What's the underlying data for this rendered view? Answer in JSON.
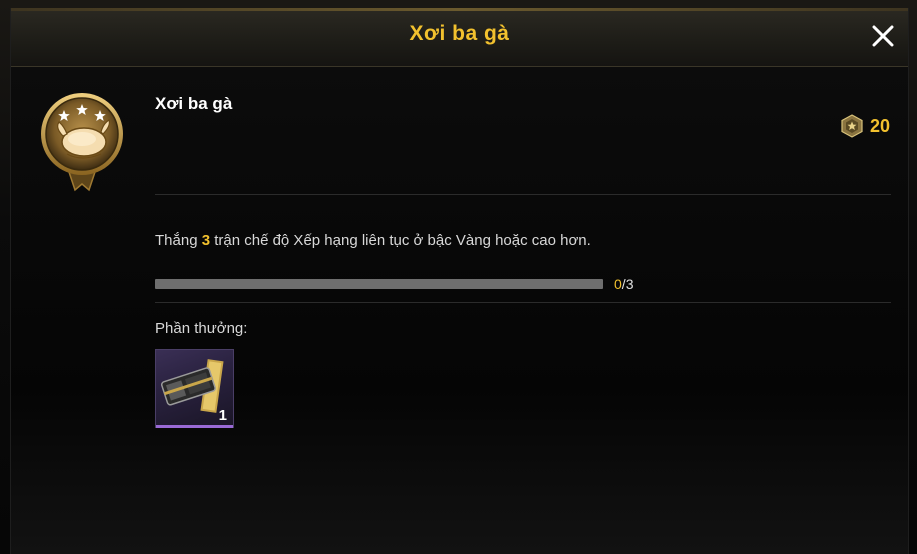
{
  "dialog": {
    "title": "Xơi ba gà",
    "close_icon": "close-icon"
  },
  "achievement": {
    "icon": "roast-chicken-badge-icon",
    "stars": 3,
    "name": "Xơi ba gà",
    "points": "20",
    "points_icon": "achievement-point-icon",
    "description_prefix": "Thắng ",
    "description_highlight": "3",
    "description_suffix": " trận chế độ Xếp hạng liên tục ở bậc Vàng hoặc cao hơn.",
    "progress": {
      "current": "0",
      "separator": "/",
      "total": "3",
      "fraction": 0
    }
  },
  "rewards": {
    "label": "Phần thưởng:",
    "items": [
      {
        "icon": "crate-coupon-icon",
        "quantity": "1",
        "rarity_color": "#9a6ad6"
      }
    ]
  },
  "colors": {
    "accent": "#f2c12e",
    "text": "#d8d8d8",
    "background": "#050505"
  }
}
